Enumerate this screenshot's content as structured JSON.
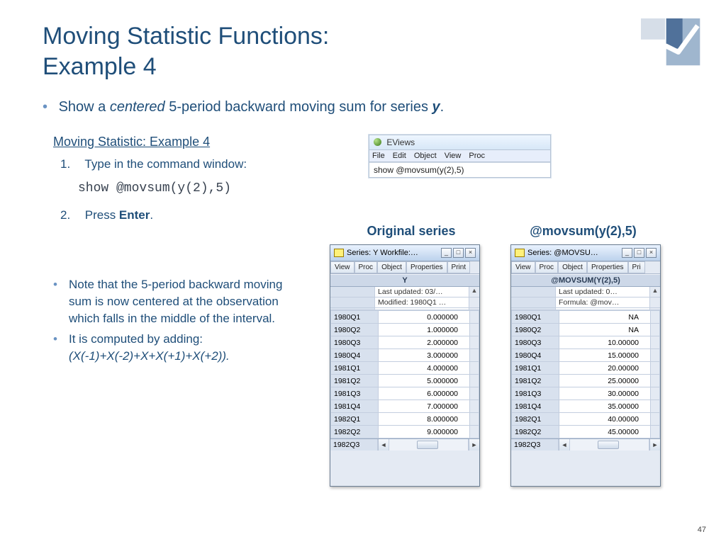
{
  "title_line1": "Moving Statistic Functions:",
  "title_line2": "Example 4",
  "main_bullet_pre": "Show a ",
  "main_bullet_em": "centered",
  "main_bullet_mid": " 5-period backward moving sum for series ",
  "main_bullet_series": "y",
  "main_bullet_post": ".",
  "subheading": "Moving Statistic: Example 4",
  "step1_num": "1.",
  "step1_text": "Type in the command window:",
  "code": "show @movsum(y(2),5)",
  "step2_num": "2.",
  "step2_pre": "Press ",
  "step2_key": "Enter",
  "step2_post": ".",
  "note1": "Note that the 5-period backward moving sum is now centered at the observation which falls in the middle of the interval.",
  "note2_pre": "It is computed by adding:",
  "note2_formula": "(X(-1)+X(-2)+X+X(+1)+X(+2)).",
  "label_a": "Original series",
  "label_b": "@movsum(y(2),5)",
  "cmdwin": {
    "title": "EViews",
    "menu": [
      "File",
      "Edit",
      "Object",
      "View",
      "Proc"
    ],
    "command": "show @movsum(y(2),5)"
  },
  "series_a": {
    "title": "Series: Y  Workfile:…",
    "toolbar": [
      "View",
      "Proc",
      "Object",
      "Properties",
      "Print"
    ],
    "header": "Y",
    "info1": "Last updated: 03/…",
    "info2": "Modified: 1980Q1 …",
    "rows": [
      [
        "1980Q1",
        "0.000000"
      ],
      [
        "1980Q2",
        "1.000000"
      ],
      [
        "1980Q3",
        "2.000000"
      ],
      [
        "1980Q4",
        "3.000000"
      ],
      [
        "1981Q1",
        "4.000000"
      ],
      [
        "1981Q2",
        "5.000000"
      ],
      [
        "1981Q3",
        "6.000000"
      ],
      [
        "1981Q4",
        "7.000000"
      ],
      [
        "1982Q1",
        "8.000000"
      ],
      [
        "1982Q2",
        "9.000000"
      ]
    ],
    "bottom": "1982Q3"
  },
  "series_b": {
    "title": "Series: @MOVSU…",
    "toolbar": [
      "View",
      "Proc",
      "Object",
      "Properties",
      "Pri"
    ],
    "header": "@MOVSUM(Y(2),5)",
    "info1": "Last updated: 0…",
    "info2": "Formula: @mov…",
    "rows": [
      [
        "1980Q1",
        "NA"
      ],
      [
        "1980Q2",
        "NA"
      ],
      [
        "1980Q3",
        "10.00000"
      ],
      [
        "1980Q4",
        "15.00000"
      ],
      [
        "1981Q1",
        "20.00000"
      ],
      [
        "1981Q2",
        "25.00000"
      ],
      [
        "1981Q3",
        "30.00000"
      ],
      [
        "1981Q4",
        "35.00000"
      ],
      [
        "1982Q1",
        "40.00000"
      ],
      [
        "1982Q2",
        "45.00000"
      ]
    ],
    "bottom": "1982Q3"
  },
  "page_number": "47"
}
